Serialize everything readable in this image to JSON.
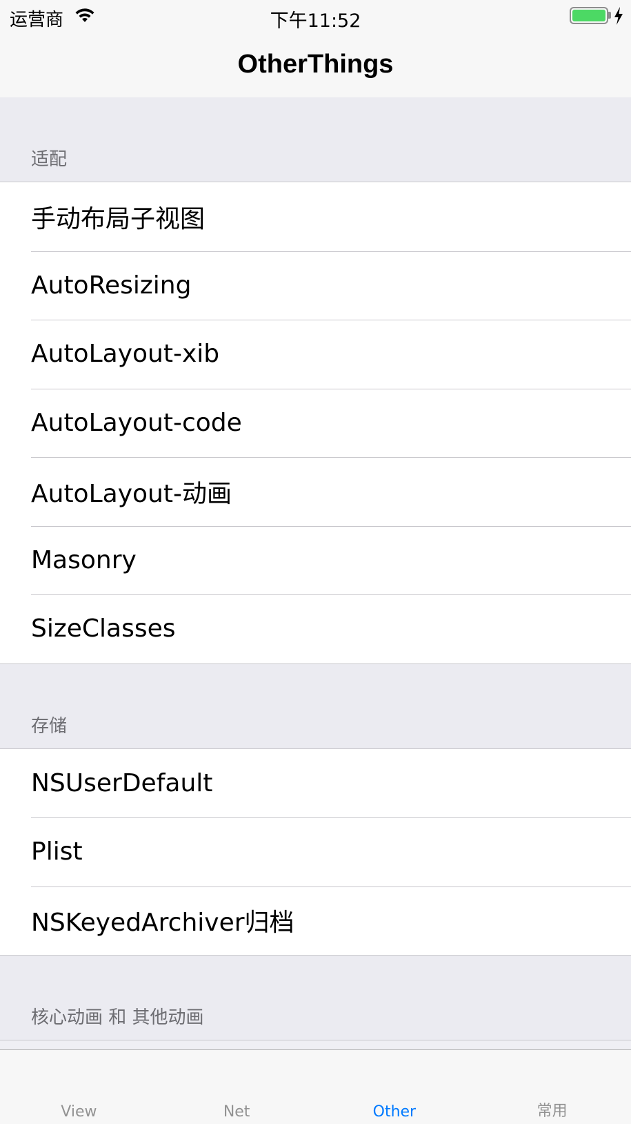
{
  "status_bar": {
    "carrier": "运营商",
    "time": "下午11:52",
    "battery_level": 1.0
  },
  "nav": {
    "title": "OtherThings"
  },
  "sections": [
    {
      "header": "适配",
      "items": [
        "手动布局子视图",
        "AutoResizing",
        "AutoLayout-xib",
        "AutoLayout-code",
        "AutoLayout-动画",
        "Masonry",
        "SizeClasses"
      ]
    },
    {
      "header": "存储",
      "items": [
        "NSUserDefault",
        "Plist",
        "NSKeyedArchiver归档"
      ]
    },
    {
      "header": "核心动画 和 其他动画",
      "items": []
    }
  ],
  "tabs": [
    {
      "label": "View",
      "active": false
    },
    {
      "label": "Net",
      "active": false
    },
    {
      "label": "Other",
      "active": true
    },
    {
      "label": "常用",
      "active": false
    }
  ],
  "colors": {
    "accent": "#007aff",
    "battery": "#4cd964",
    "tab_inactive": "#929292",
    "grouped_background": "#efeff4"
  }
}
